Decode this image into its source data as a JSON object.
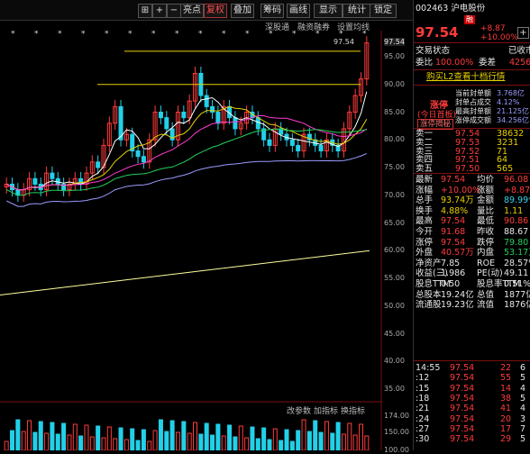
{
  "toolbar": {
    "buttons": [
      {
        "label": "⊞"
      },
      {
        "label": "+"
      },
      {
        "label": "−"
      },
      {
        "label": "亮点"
      },
      {
        "label": "复权",
        "active": true
      },
      {
        "label": "叠加"
      },
      {
        "label": "筹码"
      },
      {
        "label": "画线"
      },
      {
        "label": "显示"
      },
      {
        "label": "统计"
      },
      {
        "label": "锁定"
      }
    ],
    "subtabs": [
      "深股通",
      "融资融券",
      "设置均线"
    ]
  },
  "stock": {
    "code": "002463",
    "name": "沪电股份",
    "tag": "融",
    "price": "97.54",
    "change": "+8.87",
    "change_pct": "+10.00%"
  },
  "price_axis": [
    "97.54",
    "95.00",
    "90.00",
    "85.00",
    "80.00",
    "75.00",
    "70.00",
    "65.00",
    "60.00",
    "55.00",
    "50.00",
    "45.00",
    "40.00",
    "35.00",
    "30.00",
    "25.00"
  ],
  "price_label": "97.54",
  "vol_axis": [
    "174.00",
    "150.00",
    "100.00"
  ],
  "vol_header": [
    "改参数",
    "加指标",
    "换指标"
  ],
  "panel": {
    "trade_status_label": "交易状态",
    "trade_status_value": "已收市",
    "weibi_label": "委比",
    "weibi_value": "100.00%",
    "weicha_label": "委差",
    "weicha_value": "42567",
    "buy_link": "购买L2查看十档行情",
    "zt_title": "涨停",
    "zt_sub": "(今日首板)",
    "zt_button": "涨停揭秘",
    "zt_info": [
      {
        "k": "当前封单额",
        "v": "3.768亿"
      },
      {
        "k": "封单占成交",
        "v": "4.12%"
      },
      {
        "k": "最高封单额",
        "v": "21.125亿"
      },
      {
        "k": "涨停成交额",
        "v": "34.256亿"
      }
    ],
    "asks": [
      {
        "l": "卖一",
        "p": "97.54",
        "v": "38632"
      },
      {
        "l": "卖二",
        "p": "97.53",
        "v": "3231"
      },
      {
        "l": "卖三",
        "p": "97.52",
        "v": "71"
      },
      {
        "l": "卖四",
        "p": "97.51",
        "v": "64"
      },
      {
        "l": "卖五",
        "p": "97.50",
        "v": "565"
      }
    ],
    "stats": [
      {
        "k1": "最新",
        "v1": "97.54",
        "c1": "red",
        "k2": "均价",
        "v2": "96.08",
        "c2": "red"
      },
      {
        "k1": "涨幅",
        "v1": "+10.00%",
        "c1": "red",
        "k2": "涨额",
        "v2": "+8.87",
        "c2": "red"
      },
      {
        "k1": "总手",
        "v1": "93.74万",
        "c1": "yellow",
        "k2": "金额",
        "v2": "89.99亿",
        "c2": "cyan"
      },
      {
        "k1": "换手",
        "v1": "4.88%",
        "c1": "yellow",
        "k2": "量比",
        "v2": "1.11",
        "c2": "yellow"
      },
      {
        "k1": "最高",
        "v1": "97.54",
        "c1": "red",
        "k2": "最低",
        "v2": "90.86",
        "c2": "red"
      },
      {
        "k1": "今开",
        "v1": "91.68",
        "c1": "red",
        "k2": "昨收",
        "v2": "88.67",
        "c2": "white"
      },
      {
        "k1": "涨停",
        "v1": "97.54",
        "c1": "red",
        "k2": "跌停",
        "v2": "79.80",
        "c2": "green"
      },
      {
        "k1": "外盘",
        "v1": "40.57万",
        "c1": "red",
        "k2": "内盘",
        "v2": "53.17万",
        "c2": "green"
      },
      {
        "k1": "净资产",
        "v1": "7.85",
        "c1": "white",
        "k2": "ROE",
        "v2": "28.57%",
        "c2": "white"
      },
      {
        "k1": "收益(三)",
        "v1": "1.986",
        "c1": "white",
        "k2": "PE(动)",
        "v2": "49.11",
        "c2": "white"
      },
      {
        "k1": "股息TTM",
        "v1": "0.50",
        "c1": "white",
        "k2": "股息率TTM",
        "v2": "0.51%",
        "c2": "white"
      },
      {
        "k1": "总股本",
        "v1": "19.24亿",
        "c1": "white",
        "k2": "总值",
        "v2": "1877亿",
        "c2": "white"
      },
      {
        "k1": "流通股",
        "v1": "19.23亿",
        "c1": "white",
        "k2": "流值",
        "v2": "1876亿",
        "c2": "white"
      }
    ],
    "trades": [
      {
        "t": "14:55",
        "p": "97.54",
        "v": "22",
        "s": "6"
      },
      {
        "t": ":12",
        "p": "97.54",
        "v": "55",
        "s": "5"
      },
      {
        "t": ":15",
        "p": "97.54",
        "v": "14",
        "s": "4"
      },
      {
        "t": ":18",
        "p": "97.54",
        "v": "38",
        "s": "5"
      },
      {
        "t": ":21",
        "p": "97.54",
        "v": "41",
        "s": "4"
      },
      {
        "t": ":24",
        "p": "97.54",
        "v": "20",
        "s": "3"
      },
      {
        "t": ":27",
        "p": "97.54",
        "v": "17",
        "s": "7"
      },
      {
        "t": ":30",
        "p": "97.54",
        "v": "29",
        "s": "5"
      },
      {
        "t": ":33",
        "p": "97.54",
        "v": "33",
        "s": "4"
      },
      {
        "t": ":36",
        "p": "97.54",
        "v": "15",
        "s": "6"
      },
      {
        "t": ":39",
        "p": "97.54",
        "v": "48",
        "s": "5"
      },
      {
        "t": ":42",
        "p": "97.54",
        "v": "26",
        "s": "4"
      },
      {
        "t": ":45",
        "p": "97.54",
        "v": "31",
        "s": "6"
      },
      {
        "t": ":48",
        "p": "97.54",
        "v": "12",
        "s": "3"
      },
      {
        "t": ":51",
        "p": "97.54",
        "v": "27",
        "s": "5"
      },
      {
        "t": ":54",
        "p": "97.54",
        "v": "19",
        "s": "4"
      },
      {
        "t": ":57",
        "p": "97.54",
        "v": "36",
        "s": "6"
      },
      {
        "t": "15:00",
        "p": "97.54",
        "v": "44",
        "s": "5"
      }
    ]
  },
  "colors": {
    "up": "#ff3b3b",
    "down": "#22d0e8",
    "ma5": "#ffffff",
    "ma10": "#e8d000",
    "ma20": "#ff3bd0",
    "ma30": "#22d05a",
    "ma60": "#9a9aff",
    "ma250": "#ffffa0"
  }
}
